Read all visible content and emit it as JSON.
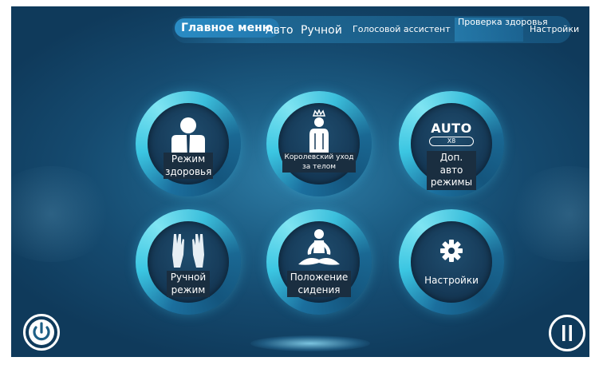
{
  "nav": {
    "tabs": [
      {
        "label": "Главное меню"
      },
      {
        "label": "Авто"
      },
      {
        "label": "Ручной"
      },
      {
        "label": "Голосовой ассистент"
      },
      {
        "label": "Проверка здоровья"
      },
      {
        "label": "Настройки"
      }
    ],
    "active_index": 0
  },
  "modes": [
    {
      "label": "Режим здоровья",
      "icon": "health-figure-icon"
    },
    {
      "label": "Королевский уход за телом",
      "icon": "royal-body-icon"
    },
    {
      "label": "Доп. авто режимы",
      "icon": "auto-icon",
      "icon_text": "AUTO",
      "icon_sub": "X8"
    },
    {
      "label": "Ручной режим",
      "icon": "hands-icon"
    },
    {
      "label": "Положение сидения",
      "icon": "lotus-seat-icon"
    },
    {
      "label": "Настройки",
      "icon": "gear-icon"
    }
  ],
  "controls": {
    "power": "power-icon",
    "pause": "pause-icon"
  },
  "colors": {
    "ring_cyan": "#3bc6e2",
    "background": "#1d5f86",
    "active_tab": "#2a8cc4"
  }
}
